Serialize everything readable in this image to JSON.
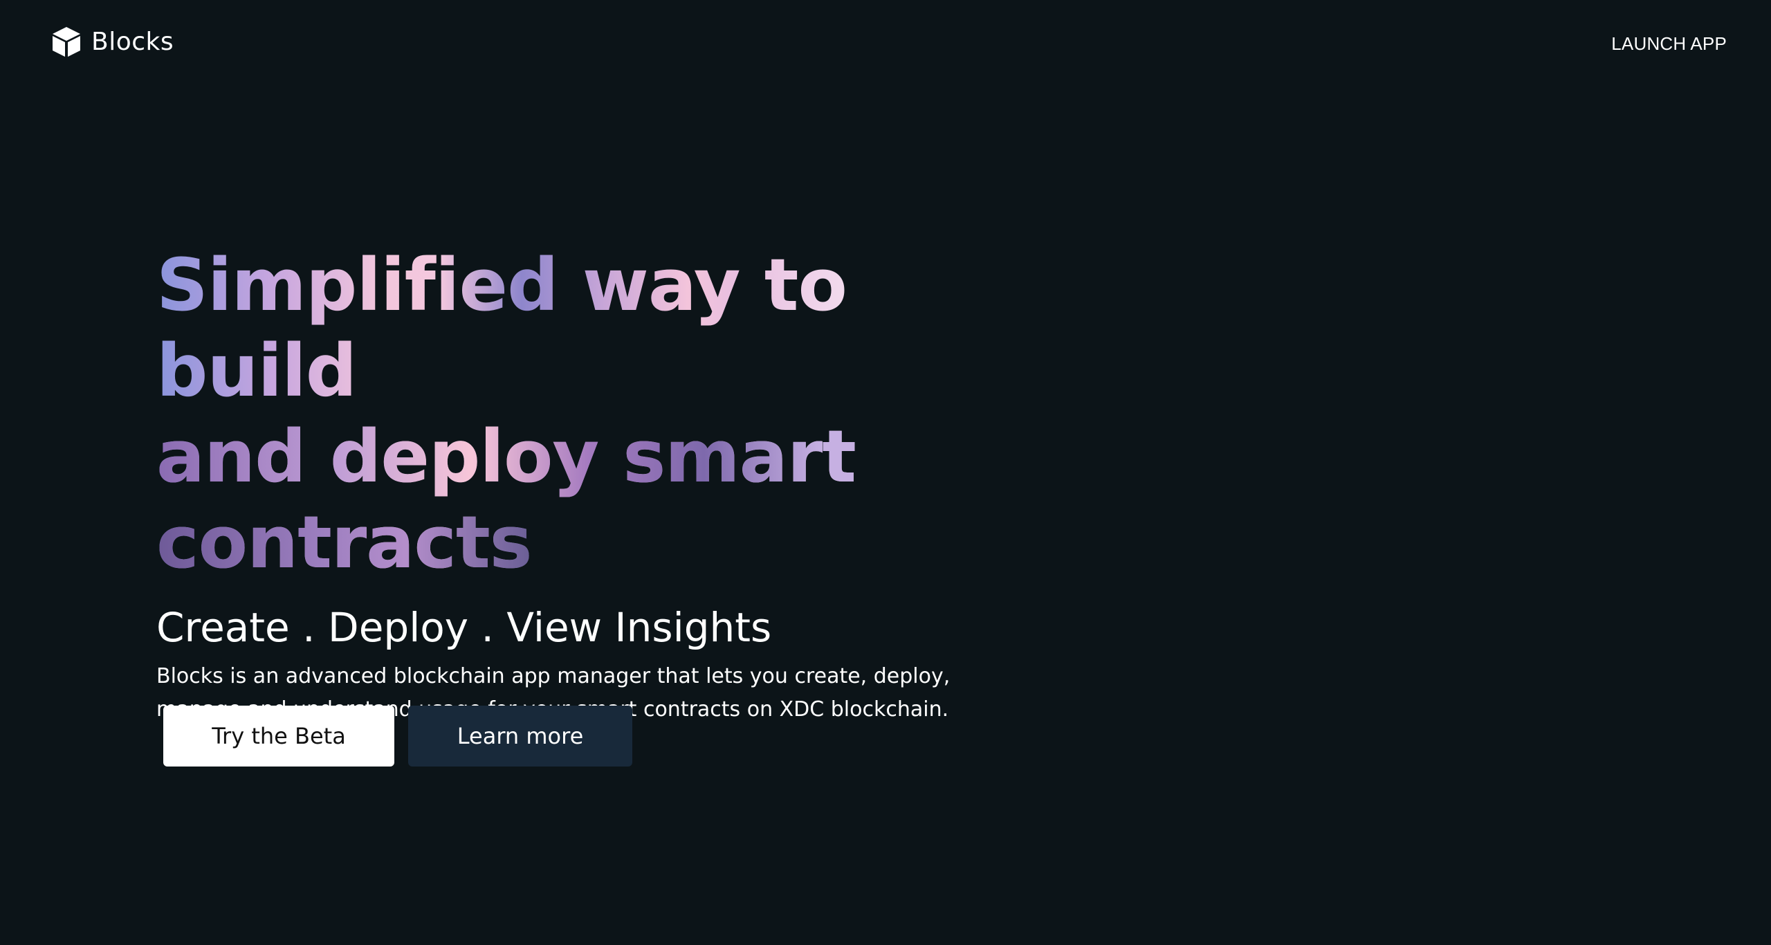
{
  "nav": {
    "brand_name": "Blocks",
    "brand_icon": "cube-icon",
    "launch_label": "LAUNCH APP"
  },
  "hero": {
    "headline_line1": "Simplified way to build",
    "headline_line2": "and deploy smart",
    "headline_line3": "contracts",
    "tagline": "Create . Deploy . View Insights",
    "description": "Blocks is an advanced blockchain app manager that lets you create, deploy, manage and understand usage for your smart contracts on XDC blockchain."
  },
  "actions": {
    "primary_label": "Try the Beta",
    "secondary_label": "Learn more"
  },
  "colors": {
    "background": "#0c1418",
    "secondary_button": "#18293a",
    "gradient_start": "#8a94dc",
    "gradient_pink": "#f2c6dc",
    "gradient_purple": "#7e69ac"
  }
}
